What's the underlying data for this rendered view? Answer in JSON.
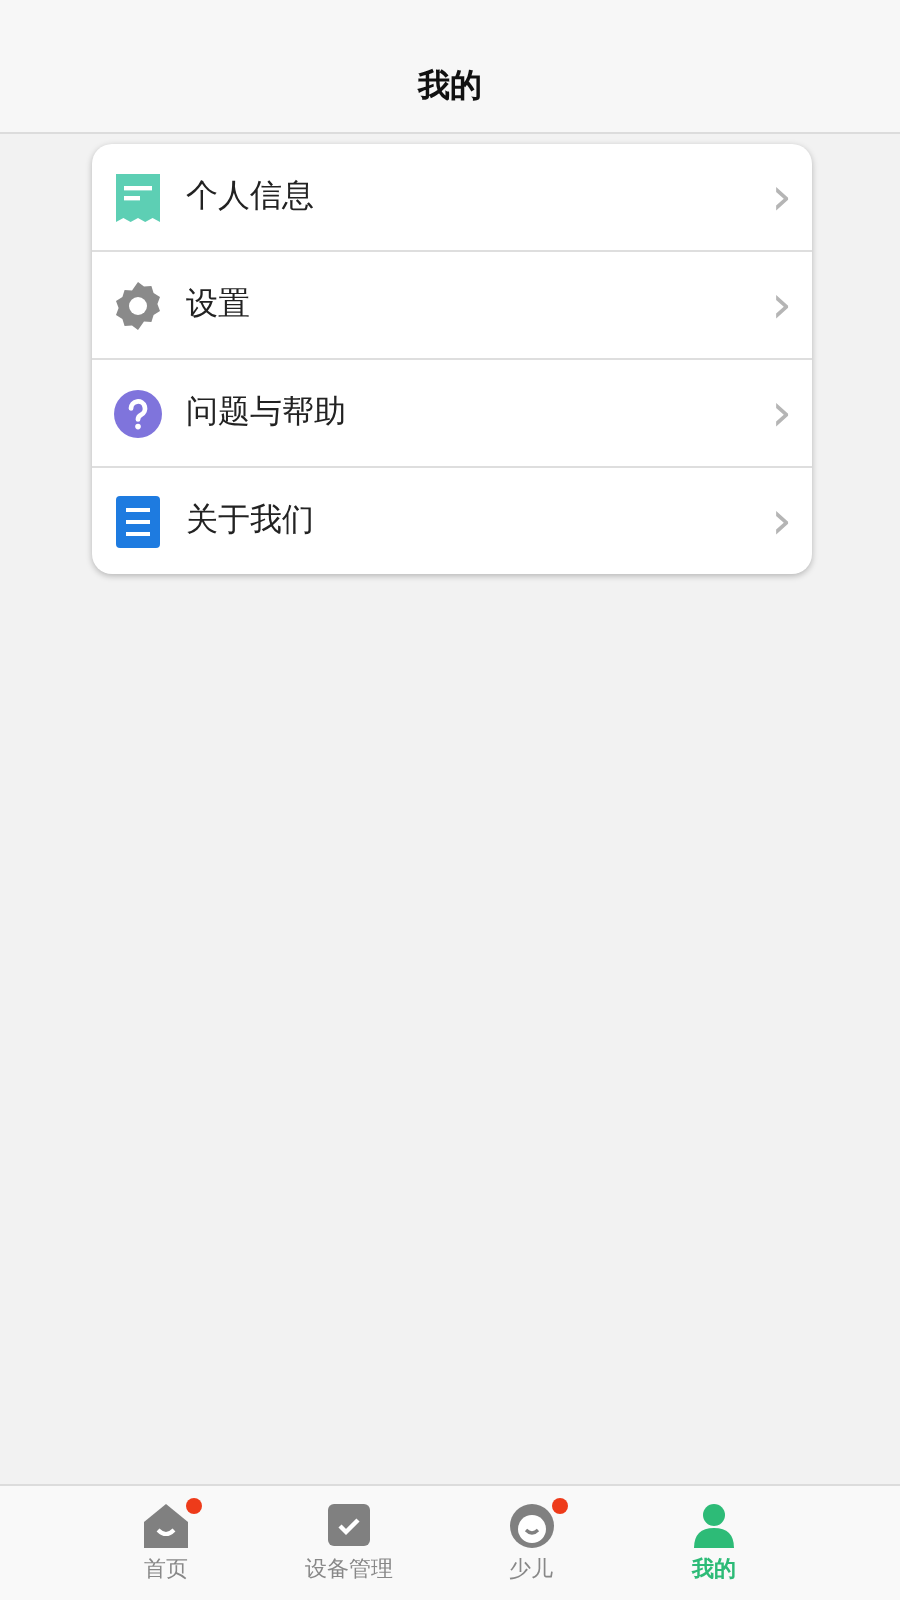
{
  "header": {
    "title": "我的"
  },
  "menu": [
    {
      "kind": "profile",
      "label": "个人信息",
      "chevron": "›"
    },
    {
      "kind": "settings",
      "label": "设置",
      "chevron": "›"
    },
    {
      "kind": "help",
      "label": "问题与帮助",
      "chevron": "›"
    },
    {
      "kind": "about",
      "label": "关于我们",
      "chevron": "›"
    }
  ],
  "tabs": [
    {
      "kind": "home",
      "label": "首页",
      "selected": false,
      "badge": true
    },
    {
      "kind": "devices",
      "label": "设备管理",
      "selected": false,
      "badge": false
    },
    {
      "kind": "child",
      "label": "少儿",
      "selected": false,
      "badge": true
    },
    {
      "kind": "me",
      "label": "我的",
      "selected": true,
      "badge": false
    }
  ]
}
